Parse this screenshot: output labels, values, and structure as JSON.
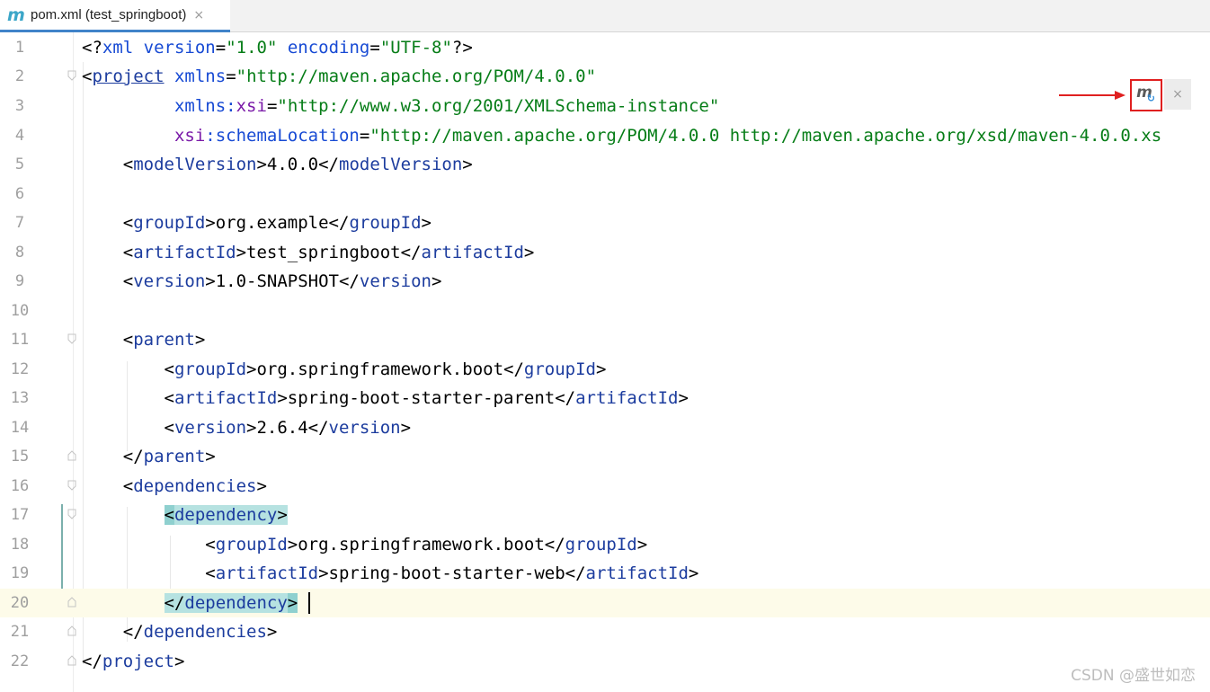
{
  "tab": {
    "icon": "maven-m-icon",
    "label": "pom.xml (test_springboot)",
    "close": "×"
  },
  "colors": {
    "tag": "#1c3c9e",
    "attribute": "#174ad4",
    "namespace": "#7a1aa8",
    "string": "#067d17",
    "highlight": "#b6e2e1",
    "current_line": "#fdfbe9",
    "annotation_red": "#e02020"
  },
  "lines": [
    {
      "n": "1",
      "t": {
        "a": "<?",
        "b": "xml ",
        "c": "version",
        "d": "=",
        "e": "\"1.0\"",
        "f": " ",
        "g": "encoding",
        "h": "=",
        "i": "\"UTF-8\"",
        "j": "?>"
      }
    },
    {
      "n": "2",
      "t": {
        "a": "<",
        "b": "project",
        "c": " ",
        "d": "xmlns",
        "e": "=",
        "f": "\"http://maven.apache.org/POM/4.0.0\""
      }
    },
    {
      "n": "3",
      "t": {
        "a": "         ",
        "b": "xmlns",
        "c": ":",
        "d": "xsi",
        "e": "=",
        "f": "\"http://www.w3.org/2001/XMLSchema-instance\""
      }
    },
    {
      "n": "4",
      "t": {
        "a": "         ",
        "b": "xsi",
        "c": ":schemaLocation",
        "d": "=",
        "e": "\"http://maven.apache.org/POM/4.0.0 http://maven.apache.org/xsd/maven-4.0.0.xs"
      }
    },
    {
      "n": "5",
      "t": {
        "a": "    <",
        "b": "modelVersion",
        "c": ">4.0.0</",
        "d": "modelVersion",
        "e": ">"
      }
    },
    {
      "n": "6",
      "t": {}
    },
    {
      "n": "7",
      "t": {
        "a": "    <",
        "b": "groupId",
        "c": ">org.example</",
        "d": "groupId",
        "e": ">"
      }
    },
    {
      "n": "8",
      "t": {
        "a": "    <",
        "b": "artifactId",
        "c": ">test_springboot</",
        "d": "artifactId",
        "e": ">"
      }
    },
    {
      "n": "9",
      "t": {
        "a": "    <",
        "b": "version",
        "c": ">1.0-SNAPSHOT</",
        "d": "version",
        "e": ">"
      }
    },
    {
      "n": "10",
      "t": {}
    },
    {
      "n": "11",
      "t": {
        "a": "    <",
        "b": "parent",
        "c": ">"
      }
    },
    {
      "n": "12",
      "t": {
        "a": "        <",
        "b": "groupId",
        "c": ">org.springframework.boot</",
        "d": "groupId",
        "e": ">"
      }
    },
    {
      "n": "13",
      "t": {
        "a": "        <",
        "b": "artifactId",
        "c": ">spring-boot-starter-parent</",
        "d": "artifactId",
        "e": ">"
      }
    },
    {
      "n": "14",
      "t": {
        "a": "        <",
        "b": "version",
        "c": ">2.6.4</",
        "d": "version",
        "e": ">"
      }
    },
    {
      "n": "15",
      "t": {
        "a": "    </",
        "b": "parent",
        "c": ">"
      }
    },
    {
      "n": "16",
      "t": {
        "a": "    <",
        "b": "dependencies",
        "c": ">"
      }
    },
    {
      "n": "17",
      "t": {
        "a": "        ",
        "b": "<",
        "c": "dependency",
        "d": ">"
      }
    },
    {
      "n": "18",
      "t": {
        "a": "            <",
        "b": "groupId",
        "c": ">org.springframework.boot</",
        "d": "groupId",
        "e": ">"
      }
    },
    {
      "n": "19",
      "t": {
        "a": "            <",
        "b": "artifactId",
        "c": ">spring-boot-starter-web</",
        "d": "artifactId",
        "e": ">"
      }
    },
    {
      "n": "20",
      "t": {
        "a": "        ",
        "b": "</",
        "c": "dependency",
        "d": ">"
      }
    },
    {
      "n": "21",
      "t": {
        "a": "    </",
        "b": "dependencies",
        "c": ">"
      }
    },
    {
      "n": "22",
      "t": {
        "a": "</",
        "b": "project",
        "c": ">"
      }
    }
  ],
  "toolbar": {
    "maven_reload_icon": "maven-reload-icon",
    "close": "×"
  },
  "watermark": "CSDN @盛世如恋"
}
